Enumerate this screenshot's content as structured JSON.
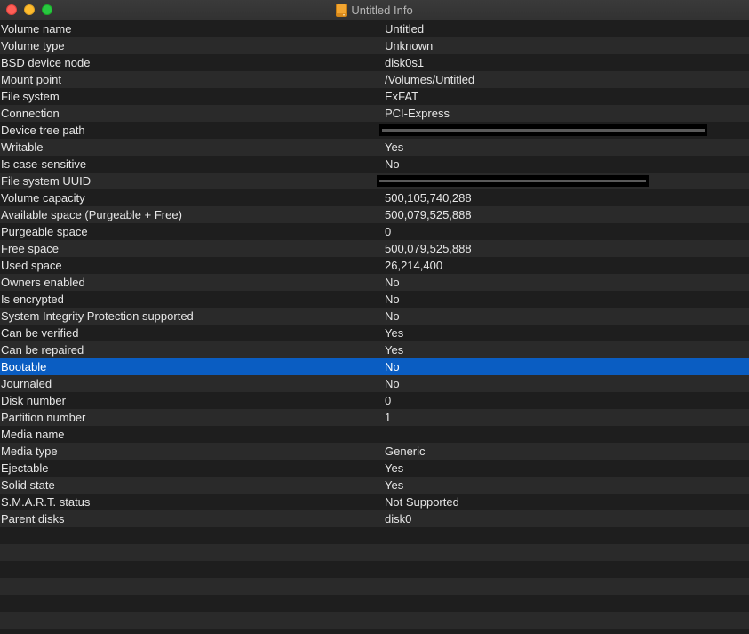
{
  "window": {
    "title": "Untitled Info",
    "title_icon": "external-disk-icon"
  },
  "rows": [
    {
      "key": "Volume name",
      "value": "Untitled"
    },
    {
      "key": "Volume type",
      "value": "Unknown"
    },
    {
      "key": "BSD device node",
      "value": "disk0s1"
    },
    {
      "key": "Mount point",
      "value": "/Volumes/Untitled"
    },
    {
      "key": "File system",
      "value": "ExFAT"
    },
    {
      "key": "Connection",
      "value": "PCI-Express"
    },
    {
      "key": "Device tree path",
      "value": ""
    },
    {
      "key": "Writable",
      "value": "Yes"
    },
    {
      "key": "Is case-sensitive",
      "value": "No"
    },
    {
      "key": "File system UUID",
      "value": ""
    },
    {
      "key": "Volume capacity",
      "value": "500,105,740,288"
    },
    {
      "key": "Available space (Purgeable + Free)",
      "value": "500,079,525,888"
    },
    {
      "key": "Purgeable space",
      "value": "0"
    },
    {
      "key": "Free space",
      "value": "500,079,525,888"
    },
    {
      "key": "Used space",
      "value": "26,214,400"
    },
    {
      "key": "Owners enabled",
      "value": "No"
    },
    {
      "key": "Is encrypted",
      "value": "No"
    },
    {
      "key": "System Integrity Protection supported",
      "value": "No"
    },
    {
      "key": "Can be verified",
      "value": "Yes"
    },
    {
      "key": "Can be repaired",
      "value": "Yes"
    },
    {
      "key": "Bootable",
      "value": "No"
    },
    {
      "key": "Journaled",
      "value": "No"
    },
    {
      "key": "Disk number",
      "value": "0"
    },
    {
      "key": "Partition number",
      "value": "1"
    },
    {
      "key": "Media name",
      "value": ""
    },
    {
      "key": "Media type",
      "value": "Generic"
    },
    {
      "key": "Ejectable",
      "value": "Yes"
    },
    {
      "key": "Solid state",
      "value": "Yes"
    },
    {
      "key": "S.M.A.R.T. status",
      "value": "Not Supported"
    },
    {
      "key": "Parent disks",
      "value": "disk0"
    }
  ],
  "selected_row": "Bootable",
  "colors": {
    "selection": "#0a5dc2",
    "row_alt": "#2a2a2a",
    "background": "#1e1e1e",
    "text": "#e6e6e6"
  }
}
